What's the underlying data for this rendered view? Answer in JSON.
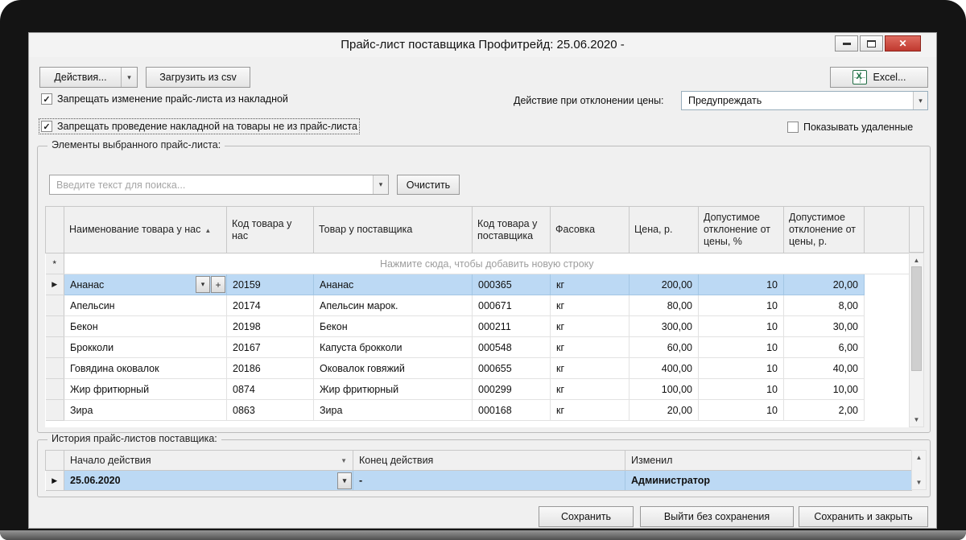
{
  "icons": {
    "close": "✕",
    "dropdown": "▾",
    "sort_asc": "▲",
    "filter": "▼",
    "scroll_up": "▲",
    "scroll_down": "▼",
    "check": "✓",
    "row_marker": "▶",
    "new_row_marker": "*",
    "plus": "+"
  },
  "window": {
    "title": "Прайс-лист поставщика Профитрейд: 25.06.2020 -"
  },
  "toolbar": {
    "actions": "Действия...",
    "load_csv": "Загрузить из csv",
    "excel": "Excel..."
  },
  "options": {
    "forbid_edit": "Запрещать изменение прайс-листа из накладной",
    "forbid_posting": "Запрещать проведение накладной на товары не из прайс-листа",
    "deviation_label": "Действие при отклонении цены:",
    "deviation_value": "Предупреждать",
    "show_deleted": "Показывать удаленные"
  },
  "items": {
    "group_title": "Элементы выбранного прайс-листа:",
    "search_placeholder": "Введите текст для поиска...",
    "clear": "Очистить",
    "new_row_hint": "Нажмите сюда, чтобы добавить новую строку",
    "columns": {
      "name": "Наименование товара у нас",
      "our_code": "Код товара у нас",
      "supplier_name": "Товар у поставщика",
      "supplier_code": "Код товара у поставщика",
      "packing": "Фасовка",
      "price": "Цена, р.",
      "dev_pct": "Допустимое отклонение от цены, %",
      "dev_rub": "Допустимое отклонение от цены, р."
    },
    "rows": [
      {
        "name": "Ананас",
        "our_code": "20159",
        "supplier_name": "Ананас",
        "supplier_code": "000365",
        "packing": "кг",
        "price": "200,00",
        "dev_pct": "10",
        "dev_rub": "20,00"
      },
      {
        "name": "Апельсин",
        "our_code": "20174",
        "supplier_name": "Апельсин марок.",
        "supplier_code": "000671",
        "packing": "кг",
        "price": "80,00",
        "dev_pct": "10",
        "dev_rub": "8,00"
      },
      {
        "name": "Бекон",
        "our_code": "20198",
        "supplier_name": "Бекон",
        "supplier_code": "000211",
        "packing": "кг",
        "price": "300,00",
        "dev_pct": "10",
        "dev_rub": "30,00"
      },
      {
        "name": "Брокколи",
        "our_code": "20167",
        "supplier_name": "Капуста брокколи",
        "supplier_code": "000548",
        "packing": "кг",
        "price": "60,00",
        "dev_pct": "10",
        "dev_rub": "6,00"
      },
      {
        "name": "Говядина оковалок",
        "our_code": "20186",
        "supplier_name": "Оковалок говяжий",
        "supplier_code": "000655",
        "packing": "кг",
        "price": "400,00",
        "dev_pct": "10",
        "dev_rub": "40,00"
      },
      {
        "name": "Жир фритюрный",
        "our_code": "0874",
        "supplier_name": "Жир фритюрный",
        "supplier_code": "000299",
        "packing": "кг",
        "price": "100,00",
        "dev_pct": "10",
        "dev_rub": "10,00"
      },
      {
        "name": "Зира",
        "our_code": "0863",
        "supplier_name": "Зира",
        "supplier_code": "000168",
        "packing": "кг",
        "price": "20,00",
        "dev_pct": "10",
        "dev_rub": "2,00"
      }
    ]
  },
  "history": {
    "group_title": "История прайс-листов поставщика:",
    "columns": {
      "start": "Начало действия",
      "end": "Конец действия",
      "changed_by": "Изменил"
    },
    "rows": [
      {
        "start": "25.06.2020",
        "end": "-",
        "changed_by": "Администратор"
      }
    ]
  },
  "footer": {
    "save": "Сохранить",
    "exit": "Выйти без сохранения",
    "save_close": "Сохранить и закрыть"
  }
}
